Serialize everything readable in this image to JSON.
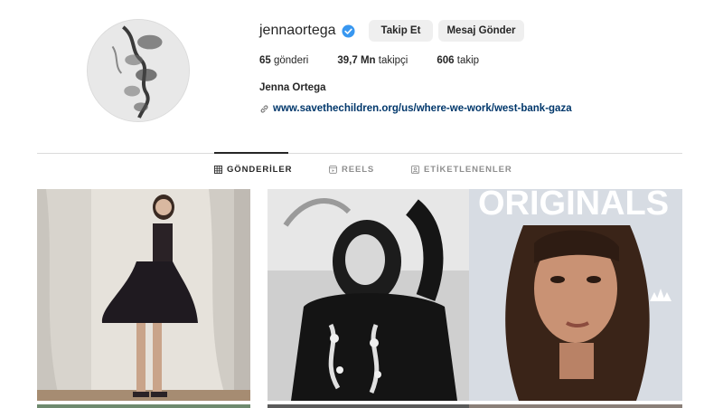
{
  "profile": {
    "username": "jennaortega",
    "follow_label": "Takip Et",
    "message_label": "Mesaj Gönder",
    "stats": {
      "posts_count": "65",
      "posts_label": "gönderi",
      "followers_count": "39,7 Mn",
      "followers_label": "takipçi",
      "following_count": "606",
      "following_label": "takip"
    },
    "full_name": "Jenna Ortega",
    "link": "www.savethechildren.org/us/where-we-work/west-bank-gaza"
  },
  "tabs": [
    {
      "label": "GÖNDERİLER",
      "icon": "grid-icon",
      "active": true
    },
    {
      "label": "REELS",
      "icon": "reels-icon",
      "active": false
    },
    {
      "label": "ETİKETLENENLER",
      "icon": "tagged-icon",
      "active": false
    }
  ],
  "posts": {
    "post3_text": "ORIGINALS"
  },
  "colors": {
    "verified": "#3897f0",
    "link": "#00376b",
    "button_bg": "#efefef",
    "divider": "#dbdbdb"
  }
}
